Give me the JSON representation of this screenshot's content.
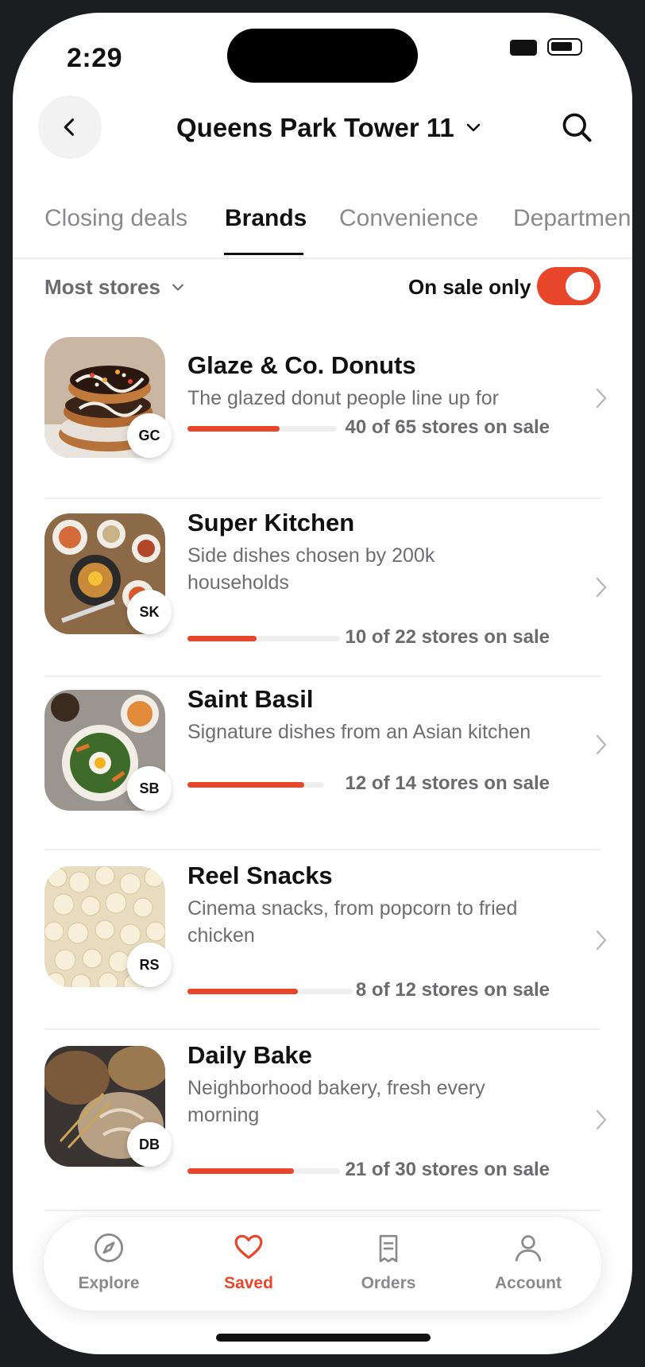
{
  "status_bar": {
    "time": "2:29"
  },
  "header": {
    "location": "Queens Park Tower 11"
  },
  "tabs": [
    {
      "label": "Closing deals",
      "active": false
    },
    {
      "label": "Brands",
      "active": true
    },
    {
      "label": "Convenience",
      "active": false
    },
    {
      "label": "Departmen",
      "active": false
    }
  ],
  "filters": {
    "sort_label": "Most stores",
    "sale_only_label": "On sale only",
    "sale_only_on": true
  },
  "brands": [
    {
      "name": "Glaze & Co. Donuts",
      "initials": "GC",
      "description": "The glazed donut people line up for",
      "stores_label": "40 of 65 stores on sale",
      "on_sale": 40,
      "total": 65
    },
    {
      "name": "Super Kitchen",
      "initials": "SK",
      "description": "Side dishes chosen by 200k households",
      "stores_label": "10 of 22 stores on sale",
      "on_sale": 10,
      "total": 22
    },
    {
      "name": "Saint Basil",
      "initials": "SB",
      "description": "Signature dishes from an Asian kitchen",
      "stores_label": "12 of 14 stores on sale",
      "on_sale": 12,
      "total": 14
    },
    {
      "name": "Reel Snacks",
      "initials": "RS",
      "description": "Cinema snacks, from popcorn to fried chicken",
      "stores_label": "8 of 12 stores on sale",
      "on_sale": 8,
      "total": 12
    },
    {
      "name": "Daily Bake",
      "initials": "DB",
      "description": "Neighborhood bakery, fresh every morning",
      "stores_label": "21 of 30 stores on sale",
      "on_sale": 21,
      "total": 30
    }
  ],
  "nav": [
    {
      "label": "Explore",
      "icon": "compass-icon",
      "active": false
    },
    {
      "label": "Saved",
      "icon": "heart-icon",
      "active": true
    },
    {
      "label": "Orders",
      "icon": "receipt-icon",
      "active": false
    },
    {
      "label": "Account",
      "icon": "person-icon",
      "active": false
    }
  ],
  "colors": {
    "accent": "#e7462a"
  }
}
